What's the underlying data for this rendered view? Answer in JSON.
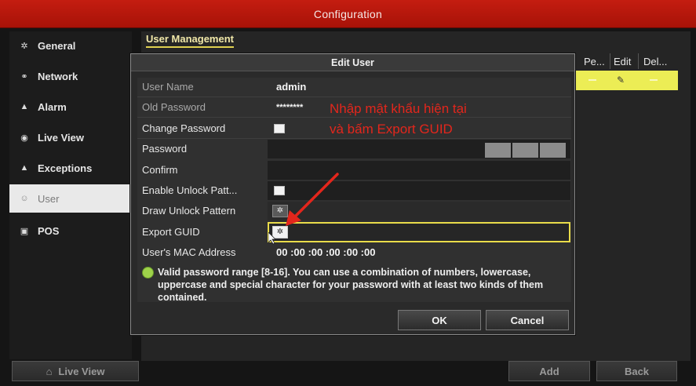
{
  "window": {
    "title": "Configuration"
  },
  "sidebar": {
    "items": [
      {
        "label": "General",
        "icon": "gear-icon",
        "active": false
      },
      {
        "label": "Network",
        "icon": "network-icon",
        "active": false
      },
      {
        "label": "Alarm",
        "icon": "alarm-icon",
        "active": false
      },
      {
        "label": "Live View",
        "icon": "eye-icon",
        "active": false
      },
      {
        "label": "Exceptions",
        "icon": "warning-icon",
        "active": false
      },
      {
        "label": "User",
        "icon": "user-icon",
        "active": true
      },
      {
        "label": "POS",
        "icon": "pos-icon",
        "active": false
      }
    ],
    "live_view_button": "Live View"
  },
  "main": {
    "tab_label": "User Management",
    "columns": [
      "Pe...",
      "Edit",
      "Del..."
    ],
    "add_button": "Add",
    "back_button": "Back"
  },
  "dialog": {
    "title": "Edit User",
    "fields": {
      "user_name_label": "User Name",
      "user_name_value": "admin",
      "old_password_label": "Old Password",
      "old_password_value": "********",
      "change_password_label": "Change Password",
      "password_label": "Password",
      "confirm_label": "Confirm",
      "enable_unlock_label": "Enable Unlock Patt...",
      "draw_unlock_label": "Draw Unlock Pattern",
      "export_guid_label": "Export GUID",
      "mac_label": "User's MAC Address",
      "mac_value": "00 :00 :00 :00 :00 :00"
    },
    "hint": "Valid password range [8-16]. You can use a combination of numbers, lowercase, uppercase and special character for your password with at least two kinds of them contained.",
    "ok_button": "OK",
    "cancel_button": "Cancel"
  },
  "annotation": {
    "line1": "Nhập mật khẩu hiện tại",
    "line2": "và bấm Export GUID",
    "color": "#e3261c"
  }
}
